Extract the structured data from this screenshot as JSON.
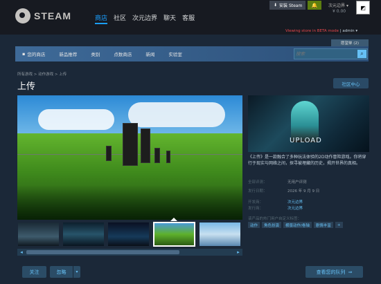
{
  "header": {
    "logo_text": "STEAM",
    "nav": [
      "商店",
      "社区",
      "次元边界",
      "聊天",
      "客服"
    ],
    "install_label": "安装 Steam",
    "user_name": "次元边界",
    "wallet": "¥ 0.00",
    "viewing_text": "Viewing store in BETA mode",
    "admin_label": "admin"
  },
  "store": {
    "wishlist_label": "愿望单 (2)",
    "nav": [
      "您的商店",
      "新品推荐",
      "类别",
      "点数商店",
      "新闻",
      "实验室"
    ],
    "search_placeholder": "搜索"
  },
  "page": {
    "breadcrumb": "所有游戏 > 动作游戏 > 上传",
    "title": "上传",
    "community_btn": "社区中心"
  },
  "game": {
    "capsule_word": "UPLOAD",
    "description": "《上传》是一款融合了多种玩法体验的2D动作冒险游戏。你将穿行于现实与网络之间，探寻被埋藏的历史，揭开世界的真相。",
    "meta": [
      {
        "label": "全部评测：",
        "value": "无用户评测",
        "link": false
      },
      {
        "label": "发行日期：",
        "value": "2026 年 9 月 9 日",
        "link": false
      },
      {
        "label": "开发商：",
        "value": "次元边界",
        "link": true
      },
      {
        "label": "发行商：",
        "value": "次元边界",
        "link": true
      }
    ],
    "tags_label": "该产品的热门用户自定义标签：",
    "tags": [
      "动作",
      "角色扮演",
      "横版动作/卷轴",
      "剧情丰富",
      "+"
    ]
  },
  "actions": {
    "follow": "关注",
    "ignore": "忽略",
    "queue": "查看您的队列"
  },
  "colors": {
    "accent": "#1a9fff",
    "link": "#66c0f4",
    "background": "#1b2838",
    "topbar": "#171a21",
    "install_green": "#5c7e10"
  }
}
